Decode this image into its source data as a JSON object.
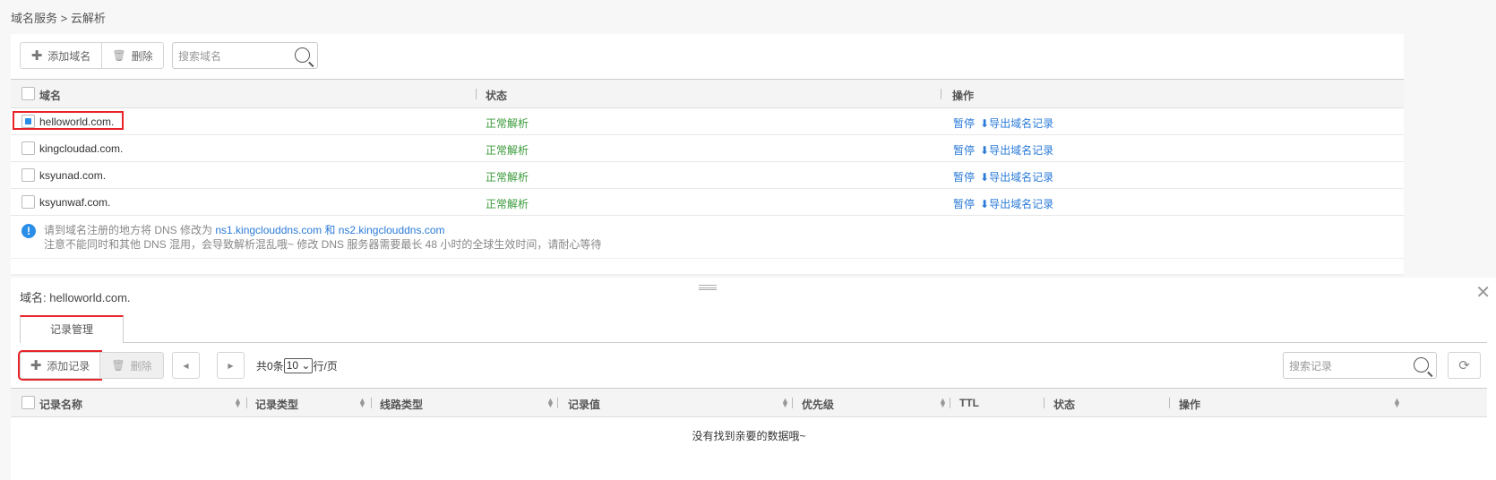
{
  "breadcrumb": "域名服务 > 云解析",
  "toolbar": {
    "add_domain": "添加域名",
    "delete": "删除",
    "search_placeholder": "搜索域名"
  },
  "domain_table": {
    "headers": [
      "域名",
      "状态",
      "操作"
    ],
    "rows": [
      {
        "domain": "helloworld.com.",
        "status": "正常解析",
        "pause": "暂停",
        "export": "导出域名记录",
        "checked": true
      },
      {
        "domain": "kingcloudad.com.",
        "status": "正常解析",
        "pause": "暂停",
        "export": "导出域名记录",
        "checked": false
      },
      {
        "domain": "ksyunad.com.",
        "status": "正常解析",
        "pause": "暂停",
        "export": "导出域名记录",
        "checked": false
      },
      {
        "domain": "ksyunwaf.com.",
        "status": "正常解析",
        "pause": "暂停",
        "export": "导出域名记录",
        "checked": false
      }
    ]
  },
  "notice": {
    "line1_prefix": "请到域名注册的地方将 DNS 修改为 ",
    "ns1": "ns1.kingclouddns.com",
    "and": " 和 ",
    "ns2": "ns2.kingclouddns.com",
    "line2": "注意不能同时和其他 DNS 混用，会导致解析混乱哦~ 修改 DNS 服务器需要最长 48 小时的全球生效时间，请耐心等待"
  },
  "detail": {
    "domain_label": "域名: helloworld.com.",
    "tab": "记录管理",
    "add_record": "添加记录",
    "delete": "删除",
    "total_prefix": "共0条",
    "page_size": "10",
    "per_page_suffix": "行/页",
    "search_placeholder": "搜索记录",
    "headers": [
      "记录名称",
      "记录类型",
      "线路类型",
      "记录值",
      "优先级",
      "TTL",
      "状态",
      "操作"
    ],
    "empty": "没有找到亲要的数据哦~"
  },
  "colors": {
    "accent": "#2a7ad8",
    "status_ok": "#3a9a3a",
    "highlight": "#e8232a"
  }
}
